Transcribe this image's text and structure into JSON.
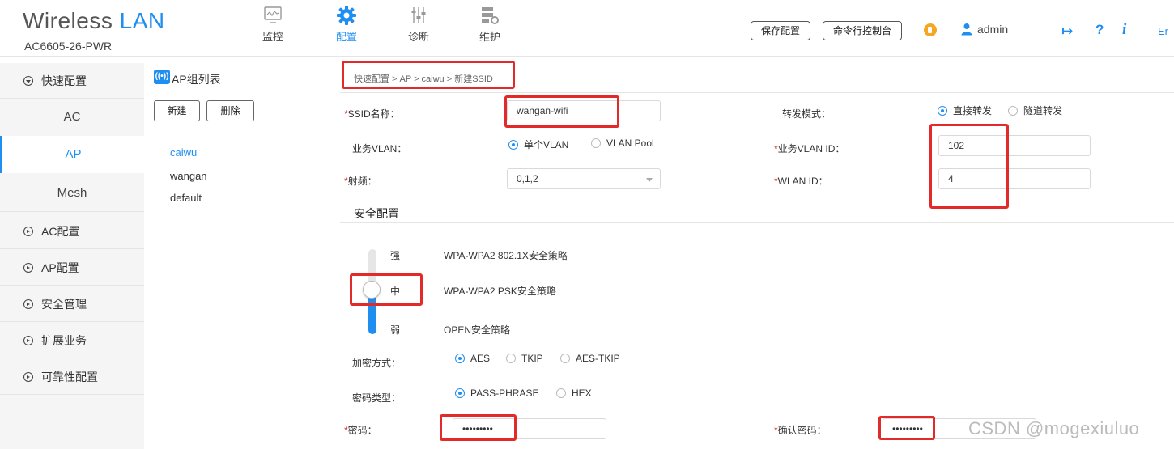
{
  "brand": {
    "title_main": "Wireless ",
    "title_accent": "LAN",
    "model": "AC6605-26-PWR"
  },
  "topnav": [
    {
      "label": "监控",
      "icon": "monitor-icon",
      "active": false
    },
    {
      "label": "配置",
      "icon": "gear-icon",
      "active": true
    },
    {
      "label": "诊断",
      "icon": "sliders-icon",
      "active": false
    },
    {
      "label": "维护",
      "icon": "server-settings-icon",
      "active": false
    }
  ],
  "header": {
    "save_config": "保存配置",
    "cli_console": "命令行控制台",
    "username": "admin",
    "lang_fragment": "Er"
  },
  "sidebar": {
    "quick_config": "快速配置",
    "sub_items": [
      "AC",
      "AP",
      "Mesh"
    ],
    "sections": [
      "AC配置",
      "AP配置",
      "安全管理",
      "扩展业务",
      "可靠性配置"
    ]
  },
  "group_panel": {
    "title": "AP组列表",
    "title_icon_text": "((•))",
    "new_button": "新建",
    "delete_button": "删除",
    "groups": [
      "caiwu",
      "wangan",
      "default"
    ]
  },
  "breadcrumb": "快速配置 > AP > caiwu > 新建SSID",
  "form": {
    "ssid_label": "SSID名称：",
    "ssid_value": "wangan-wifi",
    "forward_mode_label": "转发模式：",
    "forward_direct": "直接转发",
    "forward_tunnel": "隧道转发",
    "vlan_label": "业务VLAN：",
    "vlan_single": "单个VLAN",
    "vlan_pool": "VLAN Pool",
    "vlan_id_label": "业务VLAN ID：",
    "vlan_id_value": "102",
    "radio_label": "射频：",
    "radio_value": "0,1,2",
    "wlan_id_label": "WLAN ID：",
    "wlan_id_value": "4"
  },
  "security": {
    "title": "安全配置",
    "levels": [
      {
        "level": "强",
        "policy": "WPA-WPA2 802.1X安全策略"
      },
      {
        "level": "中",
        "policy": "WPA-WPA2 PSK安全策略"
      },
      {
        "level": "弱",
        "policy": "OPEN安全策略"
      }
    ],
    "selected_level": "中",
    "encryption_label": "加密方式：",
    "encryption_options": [
      "AES",
      "TKIP",
      "AES-TKIP"
    ],
    "encryption_selected": "AES",
    "pwd_type_label": "密码类型：",
    "pwd_type_options": [
      "PASS-PHRASE",
      "HEX"
    ],
    "pwd_type_selected": "PASS-PHRASE",
    "password_label": "密码：",
    "password_mask": "•••••••••",
    "confirm_label": "确认密码：",
    "confirm_mask": "•••••••••"
  },
  "watermark": "CSDN @mogexiuluo",
  "colors": {
    "accent": "#1f8ef1",
    "highlight": "#e32a2a",
    "required": "#e32a2a"
  }
}
